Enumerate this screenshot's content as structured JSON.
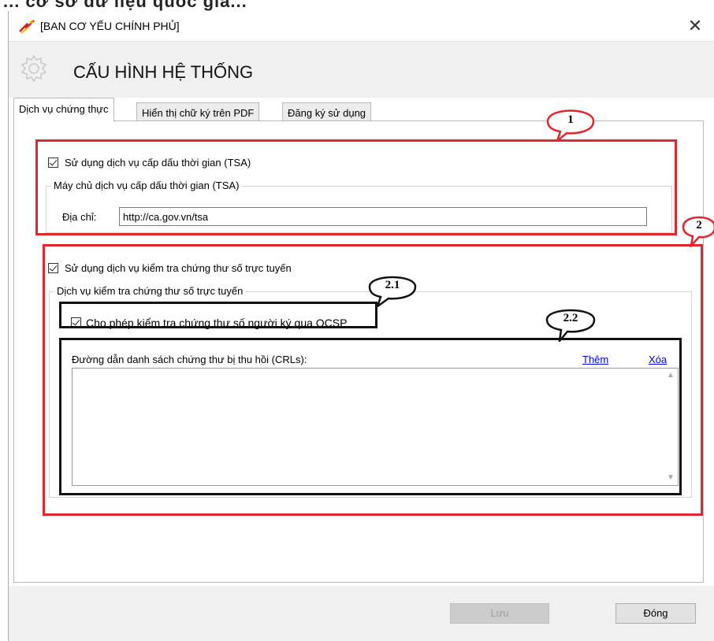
{
  "top_strip_text": "... cơ sở dữ liệu quốc gia...",
  "window": {
    "title": "[BAN CƠ YẾU CHÍNH PHỦ]",
    "close_glyph": "✕"
  },
  "header": {
    "title": "CẤU HÌNH HỆ THỐNG",
    "icon": "gear-icon"
  },
  "tabs": [
    {
      "label": "Dịch vụ chứng thực",
      "active": true
    },
    {
      "label": "Hiển thị chữ ký trên PDF",
      "active": false
    },
    {
      "label": "Đăng ký sử dụng",
      "active": false
    }
  ],
  "tsa": {
    "checkbox_label": "Sử dụng dịch vụ cấp dấu thời gian (TSA)",
    "checked": true,
    "group_label": "Máy chủ dịch vụ cấp dấu thời gian (TSA)",
    "address_label": "Địa chỉ:",
    "address_value": "http://ca.gov.vn/tsa"
  },
  "online_check": {
    "checkbox_label": "Sử dụng dịch vụ kiểm tra chứng thư số trực tuyến",
    "checked": true,
    "group_label": "Dịch vụ kiểm tra chứng thư số trực tuyến",
    "ocsp_label": "Cho phép kiểm tra chứng thư số người ký qua OCSP",
    "ocsp_checked": true,
    "crl_label": "Đường dẫn danh sách chứng thư bị thu hồi (CRLs):",
    "add_link": "Thêm",
    "delete_link": "Xóa",
    "crl_items": []
  },
  "callouts": {
    "c1": "1",
    "c2": "2",
    "c21": "2.1",
    "c22": "2.2"
  },
  "annotation_colors": {
    "red": "#e0262e",
    "black": "#111111"
  },
  "footer": {
    "save_label": "Lưu",
    "save_disabled": true,
    "close_label": "Đóng"
  }
}
